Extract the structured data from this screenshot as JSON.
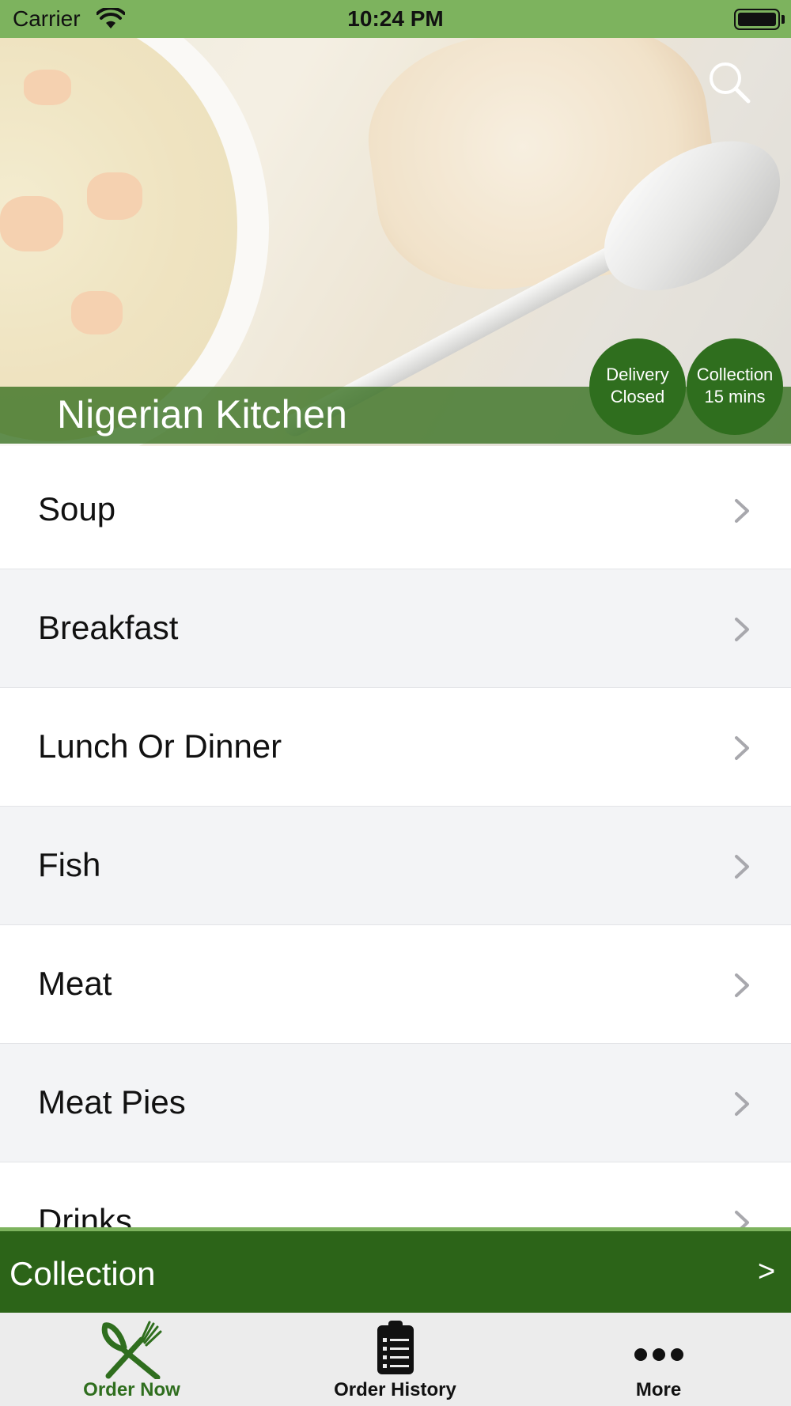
{
  "status_bar": {
    "carrier": "Carrier",
    "time": "10:24 PM"
  },
  "header": {
    "restaurant_name": "Nigerian Kitchen",
    "search_icon": "search-icon",
    "badges": {
      "delivery": {
        "line1": "Delivery",
        "line2": "Closed"
      },
      "collection": {
        "line1": "Collection",
        "line2": "15 mins"
      }
    }
  },
  "menu": {
    "categories": [
      {
        "label": "Soup"
      },
      {
        "label": "Breakfast"
      },
      {
        "label": "Lunch Or Dinner"
      },
      {
        "label": "Fish"
      },
      {
        "label": "Meat"
      },
      {
        "label": "Meat Pies"
      },
      {
        "label": "Drinks"
      }
    ]
  },
  "order_mode": {
    "label": "Collection",
    "arrow": ">"
  },
  "tabs": [
    {
      "label": "Order Now",
      "icon": "fork-knife-icon",
      "active": true
    },
    {
      "label": "Order History",
      "icon": "clipboard-icon",
      "active": false
    },
    {
      "label": "More",
      "icon": "more-dots-icon",
      "active": false
    }
  ],
  "colors": {
    "brand_green": "#2c6418",
    "status_bar_green": "#7db35e",
    "active_tab": "#2f6e1e"
  }
}
